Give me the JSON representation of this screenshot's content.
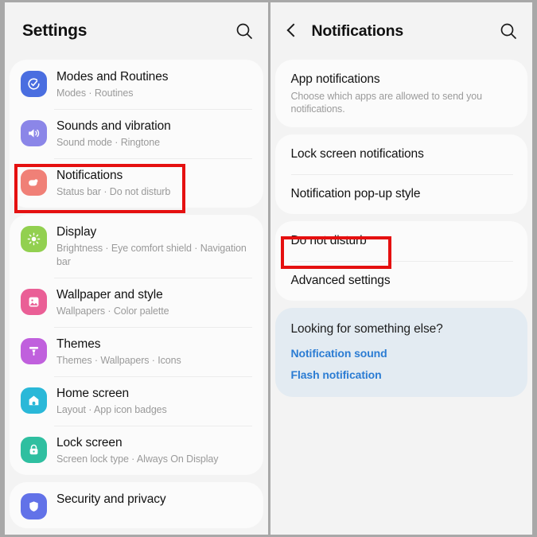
{
  "left_panel": {
    "header": {
      "title": "Settings",
      "search_icon": "search-icon"
    },
    "groups": [
      {
        "items": [
          {
            "title": "Modes and Routines",
            "subtitle": "Modes  ·  Routines",
            "icon": "modes-routines-icon",
            "icon_color": "#4a6ee0"
          },
          {
            "title": "Sounds and vibration",
            "subtitle": "Sound mode  ·  Ringtone",
            "icon": "sound-volume-icon",
            "icon_color": "#8b86e8"
          },
          {
            "title": "Notifications",
            "subtitle": "Status bar  ·  Do not disturb",
            "icon": "notifications-bell-icon",
            "icon_color": "#f08077"
          }
        ]
      },
      {
        "items": [
          {
            "title": "Display",
            "subtitle": "Brightness  ·  Eye comfort shield  ·  Navigation bar",
            "icon": "display-brightness-icon",
            "icon_color": "#92d050"
          },
          {
            "title": "Wallpaper and style",
            "subtitle": "Wallpapers  ·  Color palette",
            "icon": "wallpaper-image-icon",
            "icon_color": "#ea5f96"
          },
          {
            "title": "Themes",
            "subtitle": "Themes  ·  Wallpapers  ·  Icons",
            "icon": "themes-brush-icon",
            "icon_color": "#c060dd"
          },
          {
            "title": "Home screen",
            "subtitle": "Layout  ·  App icon badges",
            "icon": "home-house-icon",
            "icon_color": "#2ab8d8"
          },
          {
            "title": "Lock screen",
            "subtitle": "Screen lock type  ·  Always On Display",
            "icon": "lock-padlock-icon",
            "icon_color": "#2fbfa0"
          }
        ]
      },
      {
        "items": [
          {
            "title": "Security and privacy",
            "subtitle": "",
            "icon": "security-shield-icon",
            "icon_color": "#6272e8"
          }
        ]
      }
    ]
  },
  "right_panel": {
    "header": {
      "title": "Notifications",
      "back_icon": "back-chevron-icon",
      "search_icon": "search-icon"
    },
    "groups": [
      {
        "items": [
          {
            "title": "App notifications",
            "subtitle": "Choose which apps are allowed to send you notifications."
          }
        ]
      },
      {
        "items": [
          {
            "title": "Lock screen notifications",
            "subtitle": ""
          },
          {
            "title": "Notification pop-up style",
            "subtitle": ""
          }
        ]
      },
      {
        "items": [
          {
            "title": "Do not disturb",
            "subtitle": ""
          },
          {
            "title": "Advanced settings",
            "subtitle": ""
          }
        ]
      }
    ],
    "info_card": {
      "title": "Looking for something else?",
      "links": [
        "Notification sound",
        "Flash notification"
      ]
    }
  },
  "highlights": {
    "accent_color": "#e51010",
    "notifications_row": "Notifications",
    "dnd_row": "Do not disturb"
  }
}
